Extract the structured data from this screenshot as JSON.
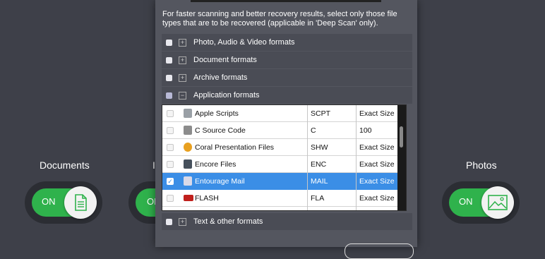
{
  "categories": {
    "documents": {
      "label": "Documents",
      "state": "ON",
      "icon": "document-icon"
    },
    "middle": {
      "label": "I",
      "state": "ON"
    },
    "photos": {
      "label": "Photos",
      "state": "ON",
      "icon": "photo-icon"
    }
  },
  "dialog": {
    "intro": "For faster scanning and better recovery results, select only those file types that are to be recovered (applicable in 'Deep Scan' only).",
    "groups": [
      {
        "label": "Photo, Audio & Video formats",
        "expander": "+"
      },
      {
        "label": "Document formats",
        "expander": "+"
      },
      {
        "label": "Archive formats",
        "expander": "+"
      },
      {
        "label": "Application formats",
        "expander": "−"
      },
      {
        "label": "Text & other formats",
        "expander": "+"
      }
    ],
    "table_rows": [
      {
        "name": "Apple Scripts",
        "ext": "SCPT",
        "size": "Exact Size",
        "checked": false,
        "icon_color": "#9aa0a6"
      },
      {
        "name": "C Source Code",
        "ext": "C",
        "size": "100",
        "checked": false,
        "icon_color": "#8c8c8c"
      },
      {
        "name": "Coral Presentation Files",
        "ext": "SHW",
        "size": "Exact Size",
        "checked": false,
        "icon_color": "#e8a020"
      },
      {
        "name": "Encore Files",
        "ext": "ENC",
        "size": "Exact Size",
        "checked": false,
        "icon_color": "#46505c"
      },
      {
        "name": "Entourage Mail",
        "ext": "MAIL",
        "size": "Exact Size",
        "checked": true,
        "icon_color": "#d9d9e8"
      },
      {
        "name": "FLASH",
        "ext": "FLA",
        "size": "Exact Size",
        "checked": false,
        "icon_color": "#c0201c"
      }
    ],
    "check_mark": "✓"
  },
  "colors": {
    "toggle_on": "#2fb24c",
    "selection": "#3b8ee6",
    "background": "#3e4049"
  }
}
